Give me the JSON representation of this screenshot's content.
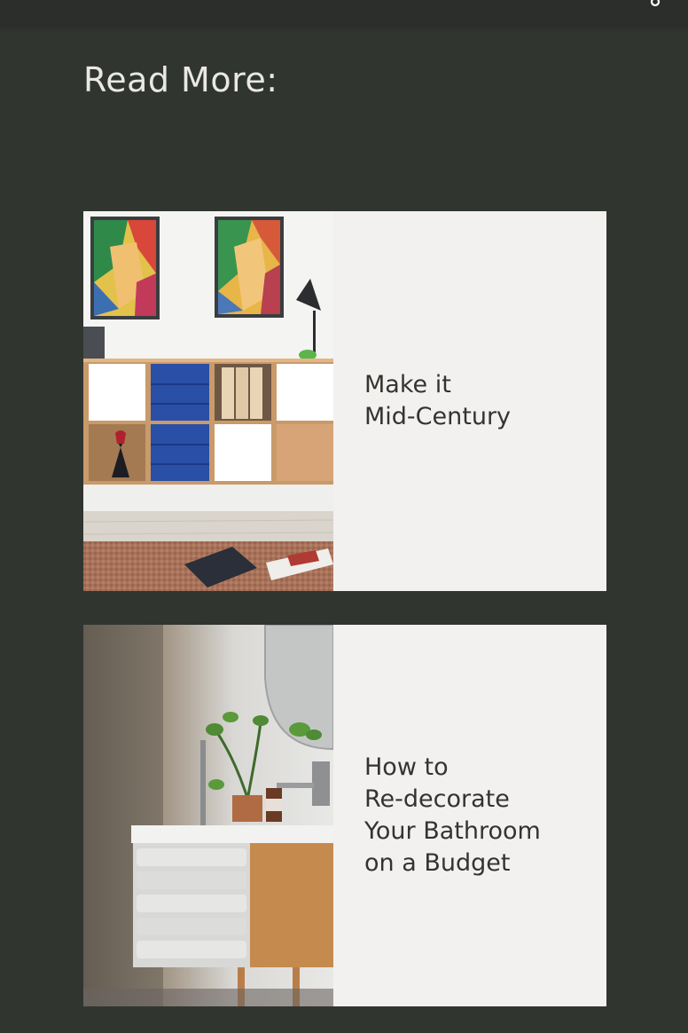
{
  "section": {
    "heading": "Read More:"
  },
  "cards": [
    {
      "title": "Make it\nMid-Century",
      "image_icon": "living-room-shelf-image"
    },
    {
      "title": "How to\nRe-decorate\nYour Bathroom\non a Budget",
      "image_icon": "bathroom-vanity-image"
    }
  ],
  "colors": {
    "background": "#313530",
    "card_text_bg": "#f3f1ef",
    "heading": "#e9e8e4",
    "title": "#333430"
  }
}
